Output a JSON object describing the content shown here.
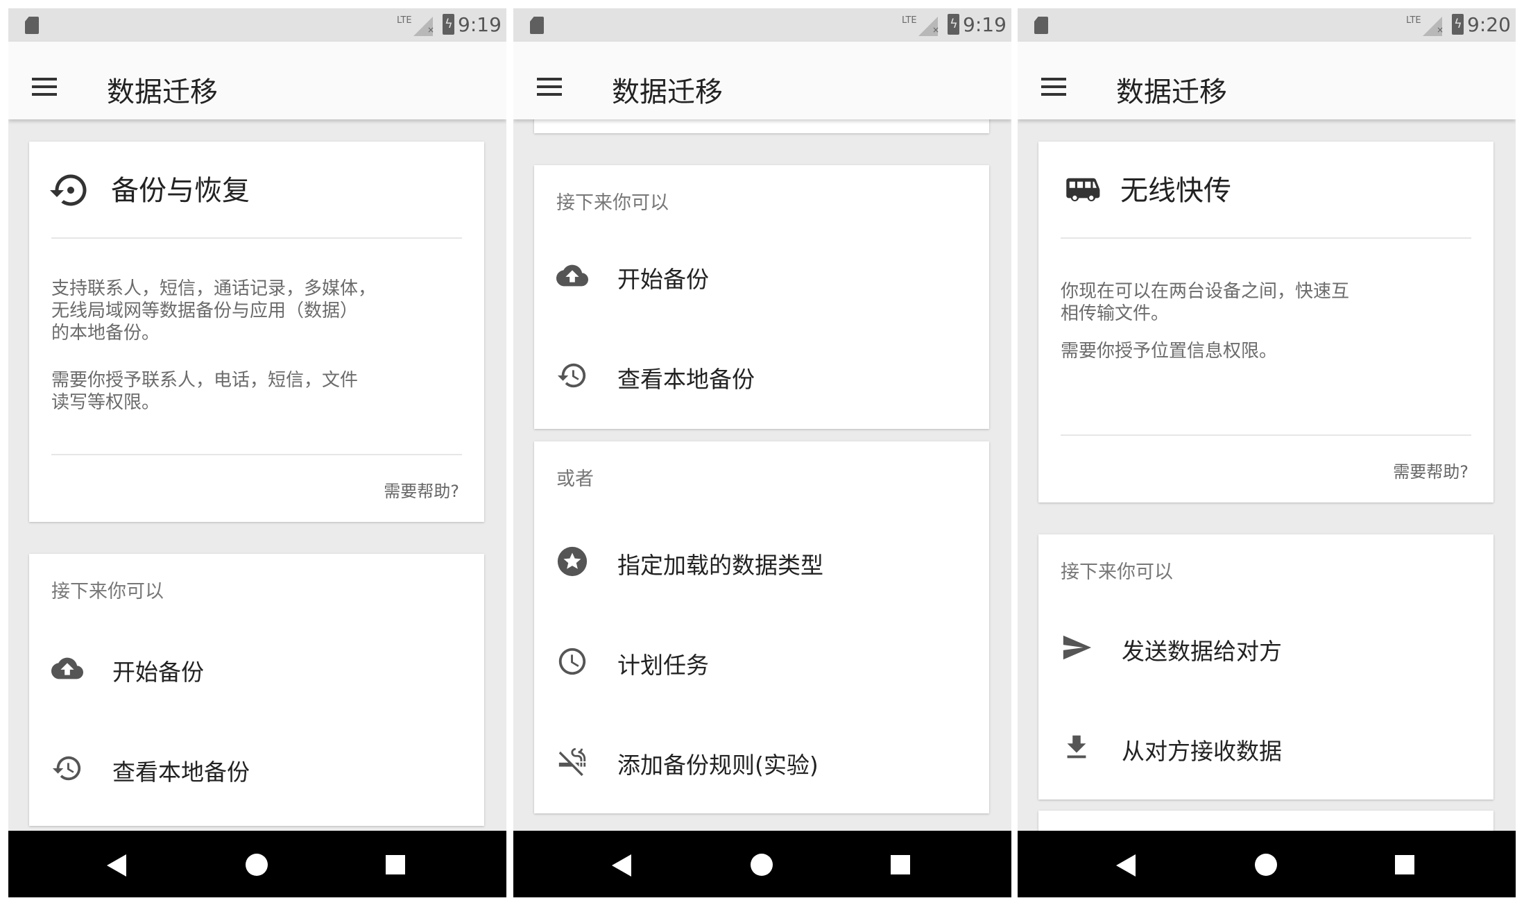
{
  "screens": [
    {
      "status": {
        "network": "LTE",
        "time": "9:19"
      },
      "app_title": "数据迁移",
      "backup_card": {
        "title": "备份与恢复",
        "description": "支持联系人，短信，通话记录，多媒体，\n无线局域网等数据备份与应用（数据）\n的本地备份。",
        "permissions": "需要你授予联系人，电话，短信，文件\n读写等权限。",
        "help": "需要帮助?"
      },
      "next_card": {
        "heading": "接下来你可以",
        "items": [
          {
            "label": "开始备份",
            "icon": "cloud-upload-icon"
          },
          {
            "label": "查看本地备份",
            "icon": "history-icon"
          }
        ]
      }
    },
    {
      "status": {
        "network": "LTE",
        "time": "9:19"
      },
      "app_title": "数据迁移",
      "next_card": {
        "heading": "接下来你可以",
        "items": [
          {
            "label": "开始备份",
            "icon": "cloud-upload-icon"
          },
          {
            "label": "查看本地备份",
            "icon": "history-icon"
          }
        ]
      },
      "or_card": {
        "heading": "或者",
        "items": [
          {
            "label": "指定加载的数据类型",
            "icon": "star-icon"
          },
          {
            "label": "计划任务",
            "icon": "clock-icon"
          },
          {
            "label": "添加备份规则(实验)",
            "icon": "no-smoking-icon"
          }
        ]
      }
    },
    {
      "status": {
        "network": "LTE",
        "time": "9:20"
      },
      "app_title": "数据迁移",
      "transfer_card": {
        "title": "无线快传",
        "description": "你现在可以在两台设备之间，快速互\n相传输文件。",
        "permissions": "需要你授予位置信息权限。",
        "help": "需要帮助?"
      },
      "next_card": {
        "heading": "接下来你可以",
        "items": [
          {
            "label": "发送数据给对方",
            "icon": "send-icon"
          },
          {
            "label": "从对方接收数据",
            "icon": "download-icon"
          }
        ]
      }
    }
  ]
}
